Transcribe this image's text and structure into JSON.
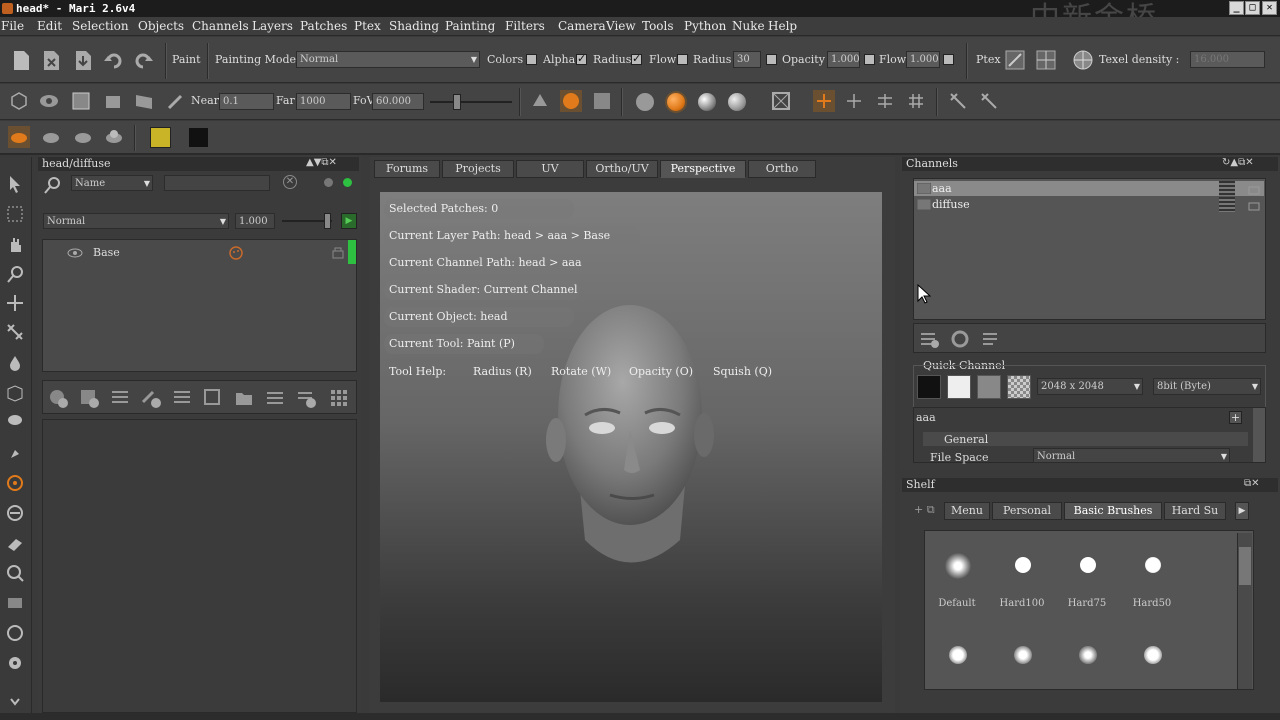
{
  "window": {
    "title": "head* - Mari 2.6v4",
    "watermark": "中新金桥"
  },
  "menu": [
    "File",
    "Edit",
    "Selection",
    "Objects",
    "Channels",
    "Layers",
    "Patches",
    "Ptex",
    "Shading",
    "Painting",
    "Filters",
    "Camera",
    "View",
    "Tools",
    "Python",
    "Nuke",
    "Help"
  ],
  "toolbar1": {
    "paint_label": "Paint",
    "painting_mode_label": "Painting Mode",
    "painting_mode_value": "Normal",
    "colors_label": "Colors",
    "alpha_label": "Alpha",
    "radius_chk_label": "Radius",
    "flow_chk_label": "Flow",
    "radius_label": "Radius",
    "radius_value": "30",
    "opacity_label": "Opacity",
    "opacity_value": "1.000",
    "flow_label": "Flow",
    "flow_value": "1.000",
    "ptex_label": "Ptex",
    "texel_label": "Texel density :",
    "texel_value": "16.000"
  },
  "toolbar2": {
    "near_label": "Near",
    "near_value": "0.1",
    "far_label": "Far",
    "far_value": "1000",
    "fov_label": "FoV",
    "fov_value": "60.000"
  },
  "colors": {
    "foreground": "#c9b428",
    "background": "#111111",
    "accent": "#e07a1a"
  },
  "layers_panel": {
    "title": "head/diffuse",
    "filter_field": "Name",
    "blend_mode": "Normal",
    "opacity": "1.000",
    "layers": [
      {
        "name": "Base"
      }
    ]
  },
  "viewport": {
    "tabs": [
      "Forums",
      "Projects",
      "UV",
      "Ortho/UV",
      "Perspective",
      "Ortho"
    ],
    "selected_tab": "Perspective",
    "info": [
      "Selected Patches: 0",
      "Current Layer Path: head > aaa > Base",
      "Current Channel Path: head > aaa",
      "Current Shader: Current Channel",
      "Current Object: head",
      "Current Tool: Paint (P)"
    ],
    "tool_help_label": "Tool Help:",
    "tool_help": [
      "Radius (R)",
      "Rotate (W)",
      "Opacity (O)",
      "Squish (Q)"
    ]
  },
  "channels_panel": {
    "title": "Channels",
    "channels": [
      "aaa",
      "diffuse"
    ],
    "quick_channel_label": "Quick Channel",
    "size_value": "2048 x 2048",
    "depth_value": "8bit (Byte)",
    "channel_name": "aaa",
    "general_label": "General",
    "file_space_label": "File Space",
    "file_space_value": "Normal"
  },
  "shelf": {
    "title": "Shelf",
    "tabs": [
      "Menu",
      "Personal",
      "Basic Brushes",
      "Hard Su"
    ],
    "selected_tab": "Basic Brushes",
    "brushes": [
      "Default",
      "Hard100",
      "Hard75",
      "Hard50"
    ]
  }
}
